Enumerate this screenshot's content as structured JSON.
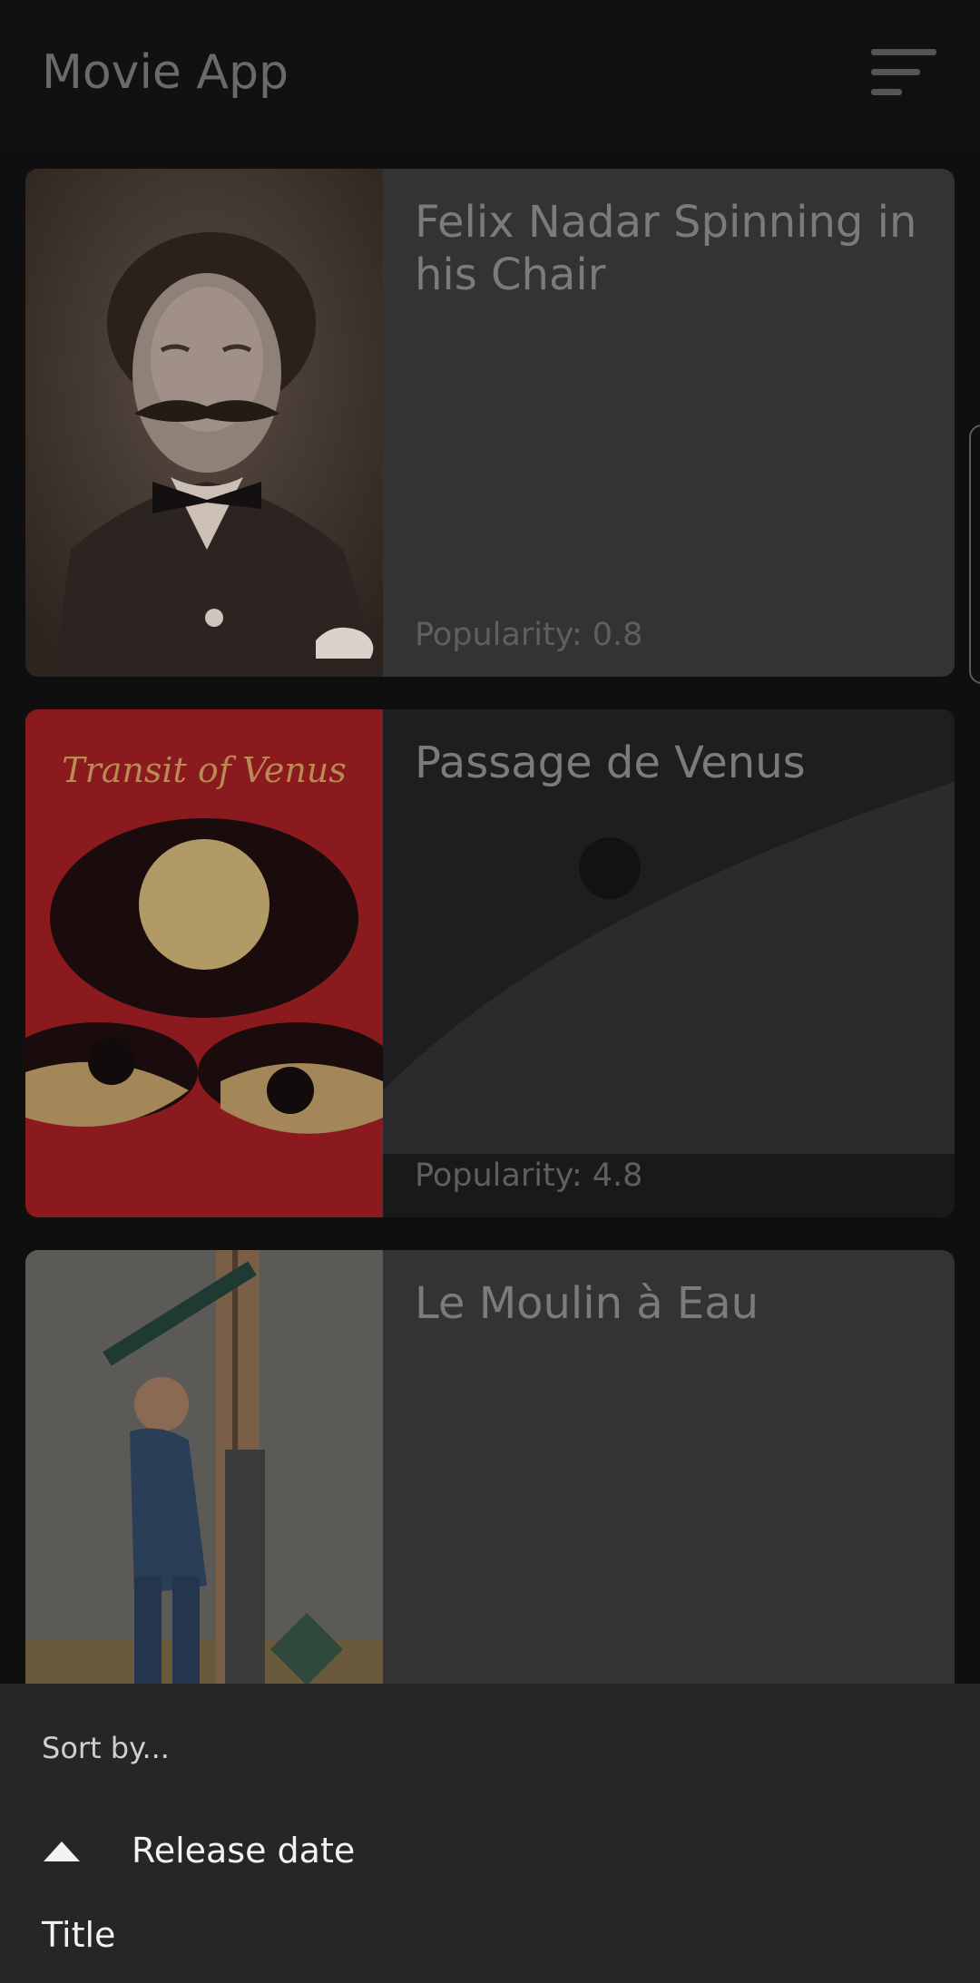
{
  "app": {
    "title": "Movie App"
  },
  "icons": {
    "sort_menu": "sort-lines-icon",
    "sort_direction": "arrow-up-icon"
  },
  "colors": {
    "background": "#0f0f10",
    "card": "#333334",
    "sheet": "#262626",
    "poster_red": "#8b1a1f"
  },
  "movies": [
    {
      "title": "Felix Nadar Spinning in his Chair",
      "popularity": "Popularity: 0.8"
    },
    {
      "title": "Passage de Venus",
      "popularity": "Popularity: 4.8"
    },
    {
      "title": "Le Moulin à Eau",
      "popularity": ""
    }
  ],
  "poster_texts": {
    "venus_poster": "Transit of Venus"
  },
  "sort_sheet": {
    "header": "Sort by...",
    "options": [
      {
        "label": "Release date",
        "selected": true
      },
      {
        "label": "Title",
        "selected": false
      }
    ]
  }
}
